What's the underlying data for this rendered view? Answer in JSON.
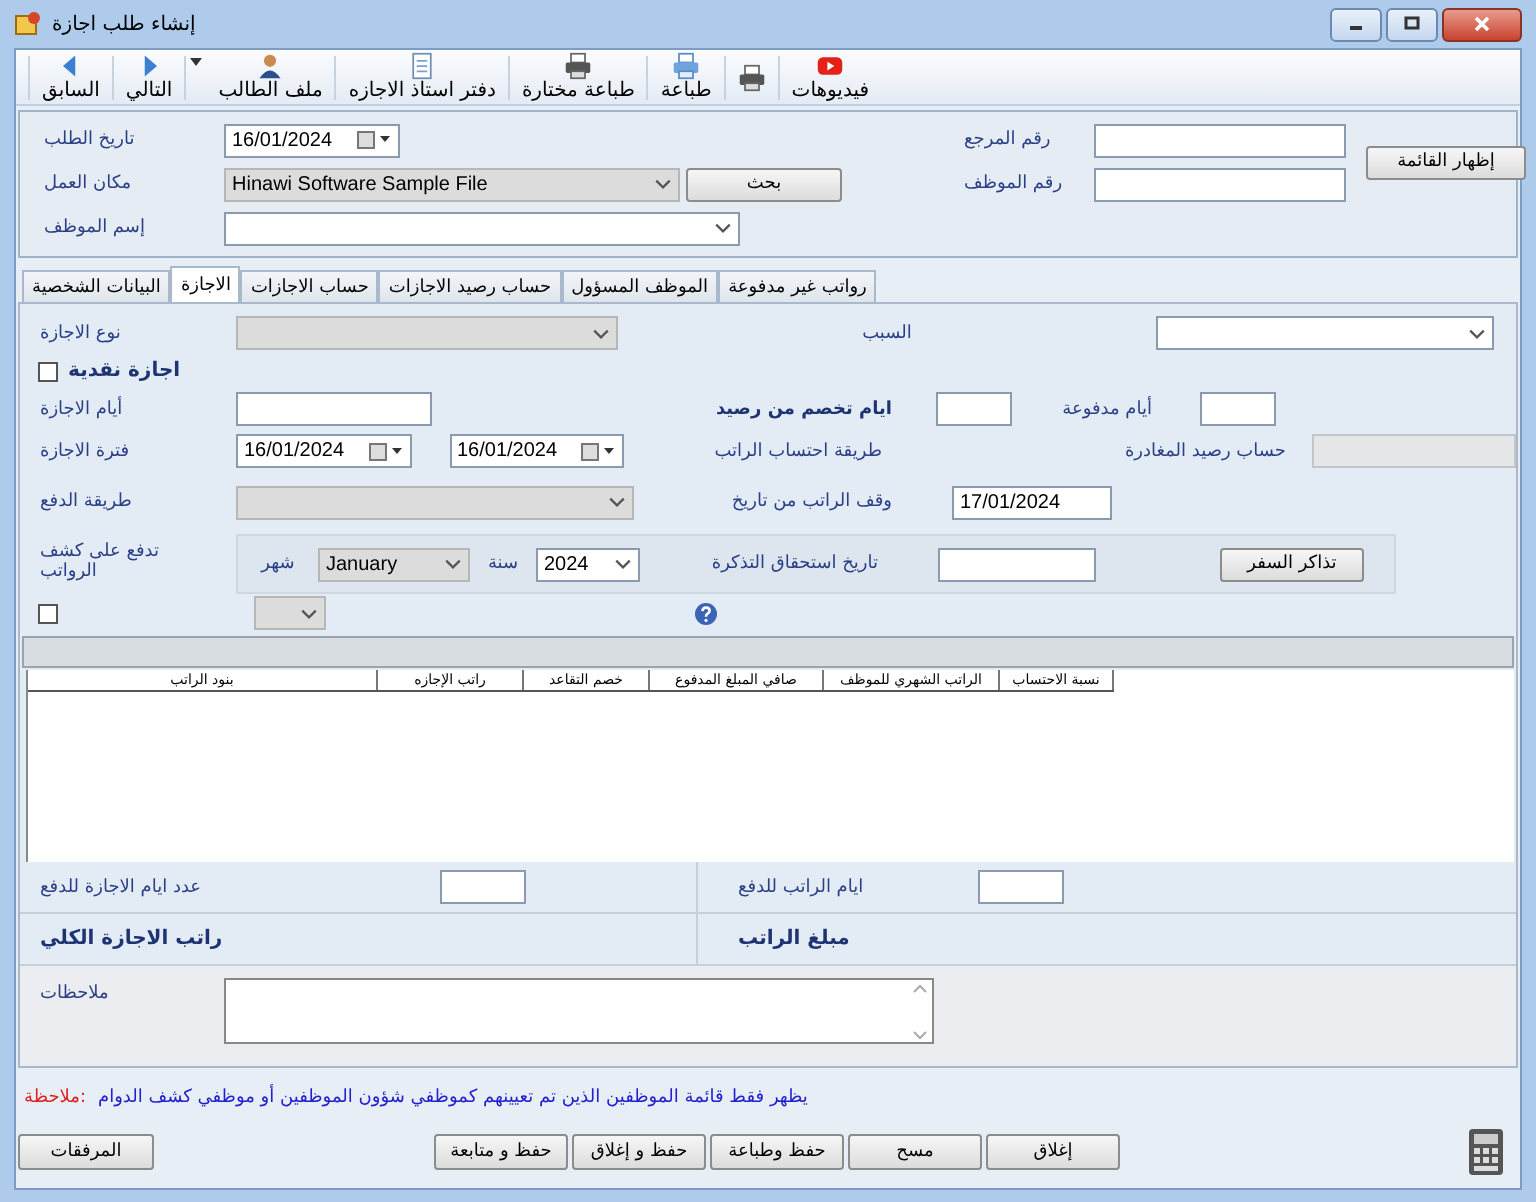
{
  "window": {
    "title": "إنشاء طلب اجازة"
  },
  "toolbar": [
    {
      "label": "فيديوهات",
      "kind": "video"
    },
    {
      "kind": "printer"
    },
    {
      "label": "طباعة",
      "kind": "preview"
    },
    {
      "label": "طباعة مختارة",
      "kind": "printer"
    },
    {
      "label": "دفتر استاذ الاجازه",
      "kind": "document"
    },
    {
      "label": "ملف الطالب",
      "kind": "person",
      "dropdown": true
    },
    {
      "label": "التالي",
      "kind": "next"
    },
    {
      "label": "السابق",
      "kind": "back"
    }
  ],
  "header": {
    "request_date": {
      "label": "تاريخ الطلب",
      "value": "16/01/2024"
    },
    "workplace": {
      "label": "مكان العمل",
      "value": "Hinawi Software Sample File",
      "disabled": true
    },
    "search_button": "بحث",
    "employee_name": {
      "label": "إسم الموظف",
      "disabled": false
    },
    "reference_no": {
      "label": "رقم المرجع"
    },
    "employee_no": {
      "label": "رقم الموظف"
    },
    "show_list_button": "إظهار القائمة"
  },
  "tabs": [
    {
      "label": "رواتب غير مدفوعة",
      "selected": false
    },
    {
      "label": "الموظف المسؤول",
      "selected": false
    },
    {
      "label": "حساب رصيد الاجازات",
      "selected": false
    },
    {
      "label": "حساب الاجازات",
      "selected": false
    },
    {
      "label": "الاجازة",
      "selected": true
    },
    {
      "label": "البيانات الشخصية",
      "selected": false
    }
  ],
  "leave": {
    "leave_type": {
      "label": "نوع الاجازة",
      "disabled": true
    },
    "reason": {
      "label": "السبب",
      "disabled": false
    },
    "cash_leave": {
      "label": "اجازة نقدية",
      "checked": false
    },
    "leave_days": {
      "label": "أيام الاجازة"
    },
    "deducted_days": {
      "label": "ايام تخصم من رصيد"
    },
    "paid_days": {
      "label": "أيام مدفوعة"
    },
    "leave_period": {
      "label": "فترة الاجازة",
      "from": "16/01/2024",
      "to": "16/01/2024"
    },
    "salary_calc_method": {
      "label": "طريقة احتساب الراتب"
    },
    "departure_balance": {
      "label": "حساب رصيد المغادرة",
      "disabled": true
    },
    "payment_method": {
      "label": "طريقة الدفع",
      "disabled": true
    },
    "salary_stop": {
      "label": "وقف الراتب من تاريخ",
      "value": "17/01/2024"
    },
    "payroll": {
      "label": "تدفع على كشف الرواتب",
      "checked": false
    },
    "month": {
      "label": "شهر",
      "value": "January",
      "disabled": true
    },
    "year": {
      "label": "سنة",
      "value": "2024",
      "disabled": false
    },
    "ticket_due": {
      "label": "تاريخ استحقاق التذكرة"
    },
    "tickets_button": "تذاكر السفر"
  },
  "table": {
    "columns": [
      "نسبة الاحتساب",
      "الراتب الشهري للموظف",
      "صافي المبلغ المدفوع",
      "خصم التقاعد",
      "راتب الإجازه",
      "بنود الراتب"
    ]
  },
  "summary": {
    "leave_days_to_pay": "عدد ايام الاجازة للدفع",
    "salary_days_to_pay": "ايام الراتب للدفع",
    "total_leave_salary": "راتب الاجازة الكلي",
    "salary_amount": "مبلغ الراتب"
  },
  "notes": {
    "label": "ملاحظات"
  },
  "note": {
    "label": "ملاحظة:",
    "text": "يظهر فقط قائمة الموظفين الذين تم تعيينهم كموظفي شؤون الموظفين أو موظفي كشف الدوام"
  },
  "buttons": {
    "attachments": "المرفقات",
    "actions": [
      "إغلاق",
      "مسح",
      "حفظ وطباعة",
      "حفظ و إغلاق",
      "حفظ و متابعة"
    ]
  }
}
